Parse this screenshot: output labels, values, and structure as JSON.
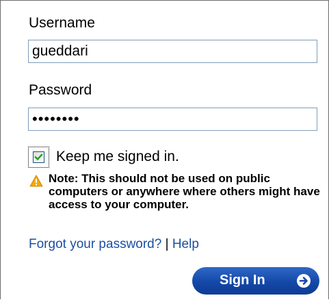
{
  "form": {
    "username_label": "Username",
    "username_value": "gueddari",
    "password_label": "Password",
    "password_value": "pass1234",
    "keep_signed_in_label": "Keep me signed in.",
    "keep_signed_in_checked": true,
    "note_text": "Note: This should not be used on public computers or anywhere where others might have access to your computer.",
    "forgot_password_link": "Forgot your password?",
    "link_separator": "|",
    "help_link": "Help",
    "sign_in_label": "Sign In"
  },
  "icons": {
    "warning": "warning-icon",
    "checkmark": "checkmark-icon",
    "arrow": "arrow-right-circle-icon"
  },
  "colors": {
    "link": "#1a4fa1",
    "button": "#1448a8",
    "warning": "#f5a800"
  }
}
